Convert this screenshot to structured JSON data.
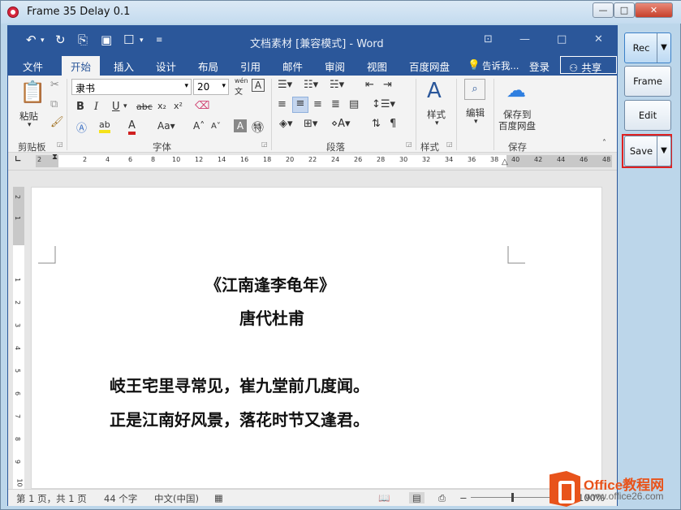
{
  "window": {
    "title": "Frame 35 Delay 0.1",
    "min": "—",
    "max": "□",
    "close": "✕"
  },
  "word": {
    "doc_title": "文档素材 [兼容模式] - Word",
    "tabs": [
      "文件",
      "开始",
      "插入",
      "设计",
      "布局",
      "引用",
      "邮件",
      "审阅",
      "视图",
      "百度网盘"
    ],
    "tell_me": "告诉我...",
    "login": "登录",
    "share": "共享",
    "ribbon": {
      "paste": "粘贴",
      "clipboard": "剪贴板",
      "font_name": "隶书",
      "font_size": "20",
      "font_group": "字体",
      "para_group": "段落",
      "style_label": "样式",
      "style_group": "样式",
      "edit_label": "编辑",
      "save_label": "保存到\n百度网盘",
      "save_to": "保存到",
      "baidu": "百度网盘",
      "save_group": "保存",
      "wen": "wén",
      "wen2": "文"
    },
    "ruler_nums": [
      "2",
      "2",
      "4",
      "6",
      "8",
      "10",
      "12",
      "14",
      "16",
      "18",
      "20",
      "22",
      "24",
      "26",
      "28",
      "30",
      "32",
      "34",
      "36",
      "38",
      "40",
      "42",
      "44",
      "46",
      "48"
    ],
    "vruler_nums": [
      "2",
      "1",
      "1",
      "2",
      "3",
      "4",
      "5",
      "6",
      "7",
      "8",
      "9",
      "10",
      "11",
      "12"
    ],
    "document": {
      "title": "《江南逢李龟年》",
      "author": "唐代杜甫",
      "line1": "岐王宅里寻常见，崔九堂前几度闻。",
      "line2": "正是江南好风景，落花时节又逢君。"
    },
    "status": {
      "page": "第 1 页，共 1 页",
      "words": "44 个字",
      "lang": "中文(中国)",
      "zoom": "100%"
    }
  },
  "side": {
    "rec": "Rec",
    "frame": "Frame",
    "edit": "Edit",
    "save": "Save"
  },
  "watermark": {
    "brand": "Office教程网",
    "url": "www.office26.com"
  },
  "colors": {
    "word_blue": "#2b579a",
    "highlight_red": "#e02020",
    "brand_orange": "#e8531b"
  }
}
